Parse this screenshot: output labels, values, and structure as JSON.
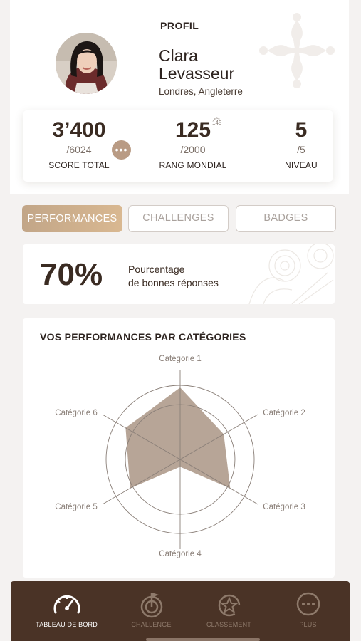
{
  "profile": {
    "title": "PROFIL",
    "first_name": "Clara",
    "last_name": "Levasseur",
    "location": "Londres, Angleterre",
    "avatar_icon": "avatar-photo"
  },
  "stats": {
    "score": {
      "value": "3’400",
      "sub": "/6024",
      "label": "SCORE TOTAL"
    },
    "rank": {
      "value": "125",
      "sub": "/2000",
      "label": "RANG MONDIAL",
      "previous": "145"
    },
    "level": {
      "value": "5",
      "sub": "/5",
      "label": "NIVEAU"
    }
  },
  "tabs": [
    {
      "label": "PERFORMANCES",
      "active": true
    },
    {
      "label": "CHALLENGES",
      "active": false
    },
    {
      "label": "BADGES",
      "active": false
    }
  ],
  "performance": {
    "percentage": "70%",
    "label_line1": "Pourcentage",
    "label_line2": "de bonnes réponses"
  },
  "categories_chart": {
    "title": "VOS PERFORMANCES PAR CATÉGORIES"
  },
  "chart_data": {
    "type": "radar",
    "title": "VOS PERFORMANCES PAR CATÉGORIES",
    "categories": [
      "Catégorie 1",
      "Catégorie 2",
      "Catégorie 3",
      "Catégorie 4",
      "Catégorie 5",
      "Catégorie 6"
    ],
    "values": [
      0.97,
      0.68,
      0.78,
      0.1,
      0.78,
      0.85
    ],
    "range": [
      0,
      1
    ],
    "rings": [
      0.74,
      1.0
    ],
    "fill_color": "#b7a597"
  },
  "nav": {
    "items": [
      {
        "label": "TABLEAU DE BORD",
        "icon": "speedometer-icon",
        "active": true
      },
      {
        "label": "CHALLENGE",
        "icon": "target-flag-icon",
        "active": false
      },
      {
        "label": "CLASSEMENT",
        "icon": "star-badge-icon",
        "active": false
      },
      {
        "label": "PLUS",
        "icon": "more-dots-icon",
        "active": false
      }
    ]
  },
  "colors": {
    "accent": "#c9ab8a",
    "nav_background": "#4a3326",
    "text_dark": "#3a2b22",
    "radar_fill": "#b7a597"
  }
}
